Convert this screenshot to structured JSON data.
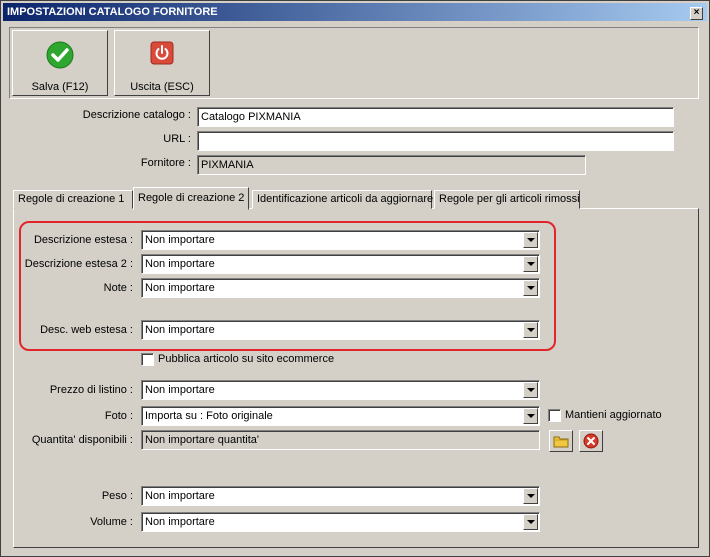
{
  "window": {
    "title": "IMPOSTAZIONI CATALOGO FORNITORE",
    "close": "×"
  },
  "toolbar": {
    "save_label": "Salva (F12)",
    "exit_label": "Uscita (ESC)"
  },
  "catalog": {
    "descrizione_label": "Descrizione catalogo :",
    "descrizione_value": "Catalogo PIXMANIA",
    "url_label": "URL :",
    "url_value": "",
    "fornitore_label": "Fornitore :",
    "fornitore_value": "PIXMANIA"
  },
  "tabs": [
    {
      "label": "Regole di creazione 1"
    },
    {
      "label": "Regole di creazione 2"
    },
    {
      "label": "Identificazione articoli da aggiornare"
    },
    {
      "label": "Regole per gli articoli rimossi"
    }
  ],
  "rules": {
    "desc_estesa_label": "Descrizione estesa :",
    "desc_estesa_value": "Non importare",
    "desc_estesa2_label": "Descrizione estesa 2 :",
    "desc_estesa2_value": "Non importare",
    "note_label": "Note :",
    "note_value": "Non importare",
    "desc_web_label": "Desc. web estesa :",
    "desc_web_value": "Non importare",
    "pubblica_label": "Pubblica articolo su sito ecommerce",
    "prezzo_label": "Prezzo di listino :",
    "prezzo_value": "Non importare",
    "foto_label": "Foto :",
    "foto_value": "Importa su : Foto originale",
    "mantieni_label": "Mantieni aggiornato",
    "quantita_label": "Quantita' disponibili :",
    "quantita_value": "Non importare quantita'",
    "peso_label": "Peso :",
    "peso_value": "Non importare",
    "volume_label": "Volume :",
    "volume_value": "Non importare"
  },
  "colors": {
    "highlight_border": "#e0262a",
    "save_icon": "#2fa62f",
    "exit_icon": "#d94a3a"
  }
}
